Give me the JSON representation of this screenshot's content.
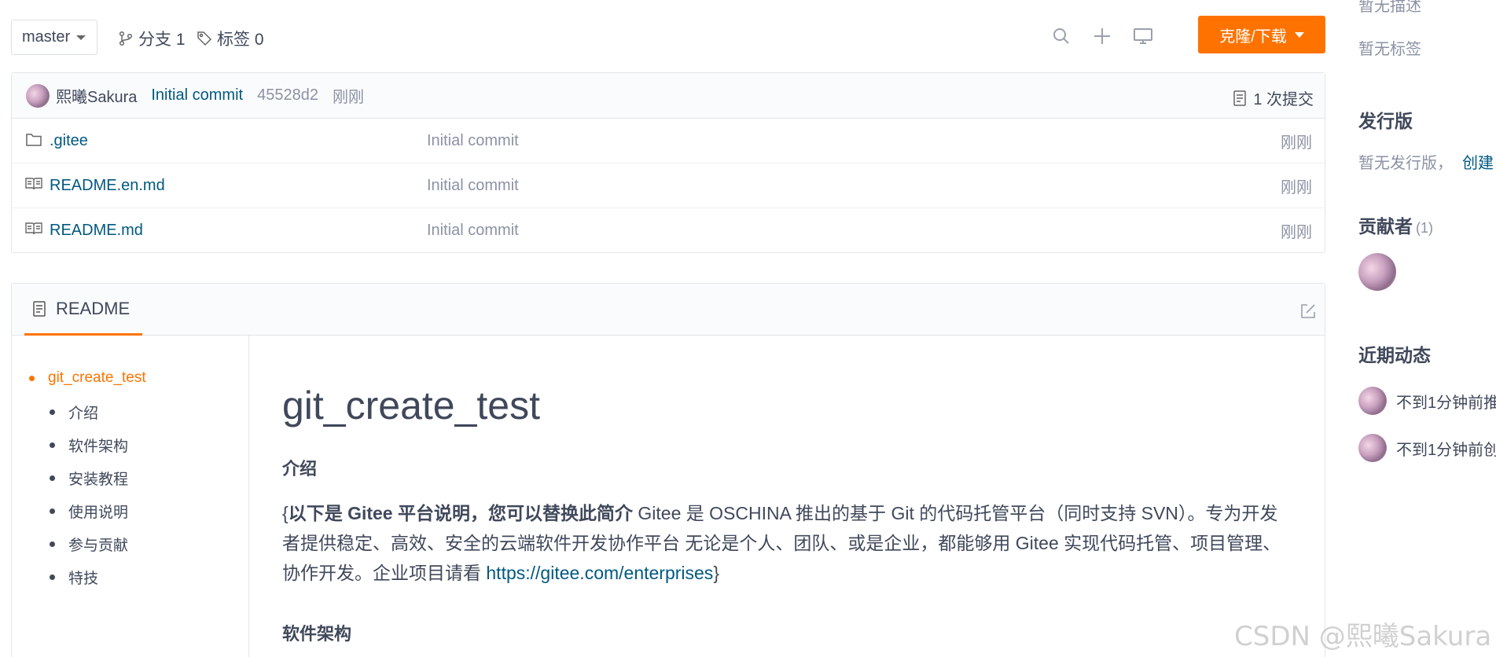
{
  "toolbar": {
    "branch": "master",
    "branches_label": "分支 1",
    "tags_label": "标签 0",
    "clone_label": "克隆/下载",
    "icons": [
      "search-icon",
      "plus-icon",
      "monitor-icon"
    ]
  },
  "last_commit": {
    "author": "熙曦Sakura",
    "message": "Initial commit",
    "hash": "45528d2",
    "time": "刚刚",
    "commit_count": "1 次提交"
  },
  "files": [
    {
      "type": "folder",
      "name": ".gitee",
      "commit": "Initial commit",
      "time": "刚刚"
    },
    {
      "type": "markdown",
      "name": "README.en.md",
      "commit": "Initial commit",
      "time": "刚刚"
    },
    {
      "type": "markdown",
      "name": "README.md",
      "commit": "Initial commit",
      "time": "刚刚"
    }
  ],
  "readme": {
    "tab_label": "README",
    "toc": [
      "git_create_test",
      "介绍",
      "软件架构",
      "安装教程",
      "使用说明",
      "参与贡献",
      "特技"
    ],
    "title": "git_create_test",
    "intro_heading": "介绍",
    "intro_brace_open": "{",
    "intro_bold": "以下是 Gitee 平台说明，您可以替换此简介",
    "intro_text": " Gitee 是 OSCHINA 推出的基于 Git 的代码托管平台（同时支持 SVN）。专为开发者提供稳定、高效、安全的云端软件开发协作平台 无论是个人、团队、或是企业，都能够用 Gitee 实现代码托管、项目管理、协作开发。企业项目请看 ",
    "intro_link": "https://gitee.com/enterprises",
    "intro_brace_close": "}",
    "arch_heading": "软件架构"
  },
  "sidebar": {
    "no_desc": "暂无描述",
    "no_tags": "暂无标签",
    "releases_title": "发行版",
    "no_releases": "暂无发行版，",
    "create_link": "创建",
    "contributors_title": "贡献者",
    "contributors_count": "(1)",
    "activity_title": "近期动态",
    "activities": [
      "不到1分钟前推",
      "不到1分钟前创"
    ]
  },
  "watermark": "CSDN @熙曦Sakura",
  "colors": {
    "accent": "#fe7300",
    "link": "#005980",
    "muted": "#8c92a4",
    "text": "#40485b"
  }
}
